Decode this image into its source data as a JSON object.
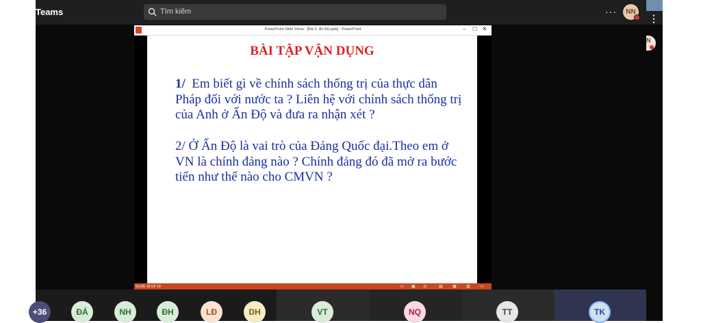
{
  "app": {
    "title": "Teams"
  },
  "search": {
    "placeholder": "Tìm kiếm"
  },
  "header": {
    "more_label": "···",
    "user_initials": "NN"
  },
  "side": {
    "more_label": "⋮",
    "avatar_initials": "N"
  },
  "ppt": {
    "window_title": "PowerPoint Slide Show - [Bài 2. Ấn Độ.pptx] - PowerPoint",
    "minimize": "–",
    "maximize": "☐",
    "close": "✕",
    "slide_counter": "SLIDE 18 OF 19"
  },
  "slide": {
    "title": "BÀI TẬP VẬN DỤNG",
    "para1_number": "1/",
    "para1_text": "Em biết gì về chính sách thống trị của thực dân Pháp đối với nước ta ? Liên hệ với chính sách thống trị của Anh ở Ấn Độ và đưa ra nhận xét ?",
    "para2_text": "2/ Ở Ấn Độ là vai trò của Đảng Quốc đại.Theo em ở VN là chính đảng nào ? Chính đảng đó đã mở ra bước tiến như thế nào cho CMVN ?"
  },
  "participants": [
    {
      "initials": "+36",
      "bg": "#4a4f7a",
      "fg": "#ffffff"
    },
    {
      "initials": "ĐÁ",
      "bg": "#d9ecd9",
      "fg": "#2e6b2e"
    },
    {
      "initials": "NH",
      "bg": "#d9ecd9",
      "fg": "#2e6b2e"
    },
    {
      "initials": "ĐH",
      "bg": "#d9ecd9",
      "fg": "#2e6b2e"
    },
    {
      "initials": "LĐ",
      "bg": "#fbe3d4",
      "fg": "#b04a1a"
    },
    {
      "initials": "DH",
      "bg": "#f4ecc6",
      "fg": "#7a6312"
    },
    {
      "initials": "VT",
      "bg": "#d9ecd9",
      "fg": "#2e6b2e"
    },
    {
      "initials": "NQ",
      "bg": "#f9d9e3",
      "fg": "#a3224b"
    },
    {
      "initials": "TT",
      "bg": "#e6e6e6",
      "fg": "#444444"
    },
    {
      "initials": "TK",
      "bg": "#cfe0f7",
      "fg": "#1f4f94"
    }
  ],
  "colors": {
    "slide_title": "#e02020",
    "slide_text": "#1a2fa0",
    "ppt_statusbar": "#c8481f",
    "status_dot": "#d13438"
  },
  "icons": [
    "search-icon",
    "more-options-icon",
    "ppt-logo-icon",
    "status-dot-icon"
  ]
}
